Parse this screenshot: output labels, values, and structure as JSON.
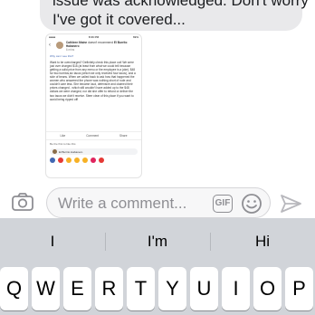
{
  "conversation": {
    "reply_line1": "issue was acknowledged. Don't worry",
    "reply_line2": "I've got it covered..."
  },
  "shared_screenshot": {
    "status_time": "8:36 PM",
    "status_battery": "69%",
    "author": "Cathleen Maine",
    "verb": "doesn't recommend",
    "page": "El Burrito Habanero",
    "timestamp": "6 mins",
    "why_link": "Why can I see this?",
    "review_text": "Want to be overcharged? Definitely check this place out! We were just over charged $16 (at least from what we could tell because getting a solid price from any menu or the employee is a joke). $48 for two burritos,six tacos (which we only received four tacos), and a side of beans. When we called back to ask how that happened the women who answered the phone was nothing short of rude and couldn't care less. She became loud, defensive and claimed their prices changed - which still wouldn't have added up to the $48 dollars we were charged, nor did she offer to refund or deliver the two tacos we didn't receive. Steer clear of this place if you want to avoid being ripped off!",
    "like_label": "Like",
    "comment_label": "Comment",
    "share_label": "Share",
    "first_like": "Be the first to like this",
    "tag": "El Burrito Habanero"
  },
  "composer": {
    "placeholder": "Write a comment...",
    "gif_label": "GIF",
    "camera_icon": "camera-icon",
    "emoji_icon": "smiley-icon",
    "send_icon": "send-icon"
  },
  "keyboard": {
    "predictions": [
      "I",
      "I'm",
      "Hi"
    ],
    "row1": [
      "Q",
      "W",
      "E",
      "R",
      "T",
      "Y",
      "U",
      "I",
      "O",
      "P"
    ]
  },
  "colors": {
    "bubble_gray": "#e9e9eb",
    "keyboard_bg": "#d1d4d9",
    "icon_gray": "#8e8e93",
    "link_blue": "#4267b2"
  }
}
